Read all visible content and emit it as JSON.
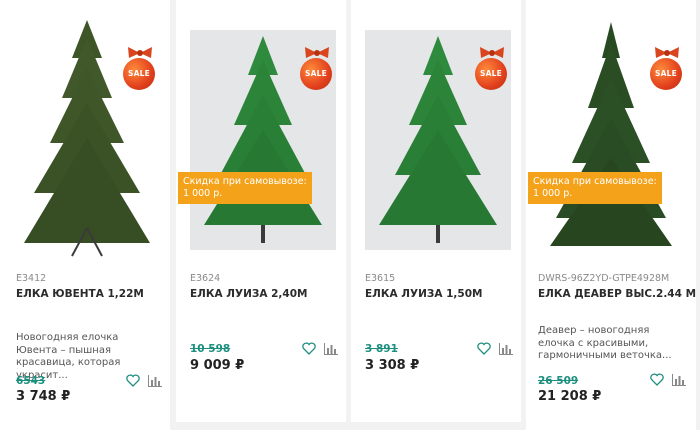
{
  "products": [
    {
      "sku": "E3412",
      "name": "ЕЛКА ЮВЕНТА 1,22М",
      "description": "Новогодняя елочка Ювента – пышная красавица, которая украсит...",
      "old_price": "6543",
      "price": "3 748 ₽",
      "sale_badge": "SALE",
      "promo": null
    },
    {
      "sku": "E3624",
      "name": "ЕЛКА ЛУИЗА 2,40М",
      "description": "",
      "old_price": "10 598",
      "price": "9 009 ₽",
      "sale_badge": "SALE",
      "promo": "Скидка при самовывозе:\n1 000 р."
    },
    {
      "sku": "E3615",
      "name": "ЕЛКА ЛУИЗА 1,50М",
      "description": "",
      "old_price": "3 891",
      "price": "3 308 ₽",
      "sale_badge": "SALE",
      "promo": null
    },
    {
      "sku": "DWRS-96Z2YD-GTPE4928M",
      "name": "ЕЛКА ДЕАВЕР ВЫС.2.44 М",
      "description": "Деавер – новогодняя елочка с красивыми, гармоничными веточка...",
      "old_price": "26 509",
      "price": "21 208 ₽",
      "sale_badge": "SALE",
      "promo": "Скидка при самовывозе:\n1 000 р."
    }
  ],
  "icons": {
    "favorite": "heart-outline-icon",
    "compare": "bar-chart-icon"
  },
  "colors": {
    "accent": "#1c8f7f",
    "promo": "#f5a21b",
    "sale": "#e2401d"
  }
}
